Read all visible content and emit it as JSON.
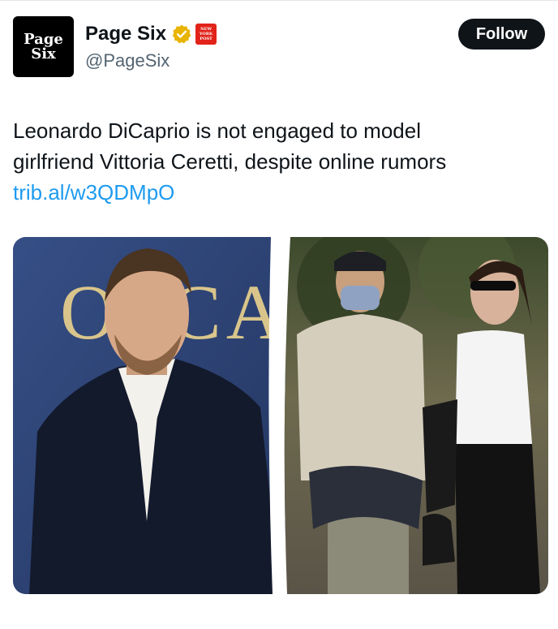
{
  "account": {
    "display_name": "Page Six",
    "handle": "@PageSix",
    "avatar_line1": "Page",
    "avatar_line2": "Six",
    "verified_color": "#e8b400",
    "affiliate_badge_lines": [
      "NEW",
      "YORK",
      "POST"
    ]
  },
  "follow_label": "Follow",
  "tweet": {
    "line1": "Leonardo DiCaprio is not engaged to model",
    "line2": "girlfriend Vittoria Ceretti, despite online rumors",
    "link": "trib.al/w3QDMpO"
  },
  "media": {
    "backdrop_letters": "OSCA"
  }
}
